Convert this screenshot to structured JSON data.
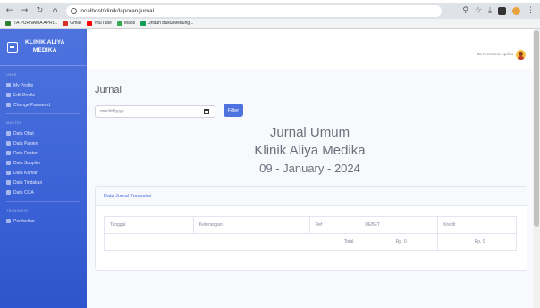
{
  "browser": {
    "url": "localhost/klinik/laporan/jurnal",
    "bookmarks": [
      "ITA PURNAMA APRI...",
      "Gmail",
      "YouTube",
      "Maps",
      "Unduh Buku/Menung..."
    ]
  },
  "sidebar": {
    "brand_line1": "KLINIK ALIYA",
    "brand_line2": "MEDIKA",
    "sections": [
      {
        "heading": "USER",
        "items": [
          "My Profile",
          "Edit Profile",
          "Change Password"
        ]
      },
      {
        "heading": "MASTER",
        "items": [
          "Data Obat",
          "Data Pasien",
          "Data Dokter",
          "Data Supplier",
          "Data Kamar",
          "Data Tindakan",
          "Data COA"
        ]
      },
      {
        "heading": "TRANSAKSI",
        "items": [
          "Pembelian"
        ]
      }
    ]
  },
  "topbar": {
    "user_name": "Ita Purnama Aprilia"
  },
  "main": {
    "title": "Jurnal",
    "date_placeholder": "mm/dd/yyyy",
    "filter_label": "Filter",
    "report_title": "Jurnal Umum",
    "report_org": "Klinik Aliya Medika",
    "report_date": "09 - January - 2024",
    "card_title": "Data Jurnal Transaksi",
    "columns": [
      "Tanggal",
      "Keterangan",
      "Ref",
      "DEBET",
      "Kredit"
    ],
    "total_label": "Total",
    "total_debet": "Rp. 0",
    "total_kredit": "Rp. 0"
  },
  "colors": {
    "primary": "#4e73df",
    "background": "#f8f9fc"
  }
}
